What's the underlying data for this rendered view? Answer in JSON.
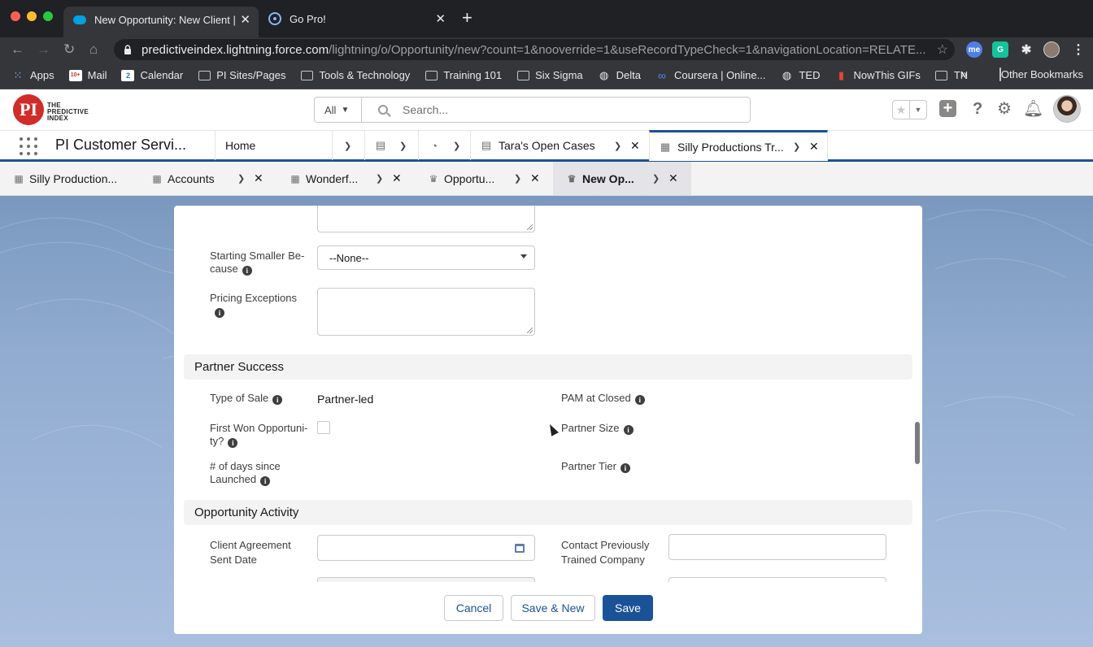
{
  "browser": {
    "tabs": [
      {
        "title": "New Opportunity: New Client |",
        "active": true
      },
      {
        "title": "Go Pro!",
        "active": false
      }
    ],
    "url_host": "predictiveindex.lightning.force.com",
    "url_path": "/lightning/o/Opportunity/new?count=1&nooverride=1&useRecordTypeCheck=1&navigationLocation=RELATE...",
    "bookmarks": [
      {
        "label": "Apps",
        "icon": "apps-grid-icon"
      },
      {
        "label": "Mail",
        "icon": "gmail-icon"
      },
      {
        "label": "Calendar",
        "icon": "calendar-icon"
      },
      {
        "label": "PI Sites/Pages",
        "icon": "folder-icon"
      },
      {
        "label": "Tools & Technology",
        "icon": "folder-icon"
      },
      {
        "label": "Training 101",
        "icon": "folder-icon"
      },
      {
        "label": "Six Sigma",
        "icon": "folder-icon"
      },
      {
        "label": "Delta",
        "icon": "globe-icon"
      },
      {
        "label": "Coursera | Online...",
        "icon": "coursera-icon"
      },
      {
        "label": "TED",
        "icon": "globe-icon"
      },
      {
        "label": "NowThis GIFs",
        "icon": "bookmark-icon"
      },
      {
        "label": "TN",
        "icon": "folder-icon"
      }
    ],
    "bookmarks_more": "»",
    "other_bookmarks": "Other Bookmarks",
    "calendar_badge": "2",
    "mail_badge": "10+"
  },
  "sf_header": {
    "logo_letters": "PI",
    "logo_text": [
      "THE",
      "PREDICTIVE",
      "INDEX"
    ],
    "search_scope": "All",
    "search_placeholder": "Search..."
  },
  "app_nav": {
    "app_name": "PI Customer Servi...",
    "tabs": [
      {
        "label": "Home"
      },
      {
        "label": ""
      },
      {
        "label": ""
      },
      {
        "label": "Tara's Open Cases"
      },
      {
        "label": "Silly Productions Tr..."
      }
    ]
  },
  "subtabs": [
    {
      "label": "Silly Production..."
    },
    {
      "label": "Accounts"
    },
    {
      "label": "Wonderf..."
    },
    {
      "label": "Opportu..."
    },
    {
      "label": "New Op..."
    }
  ],
  "form": {
    "starting_smaller": {
      "label": "Starting Smaller Be- cause",
      "value": "--None--"
    },
    "pricing_exceptions": {
      "label": "Pricing Exceptions"
    },
    "partner_section": {
      "title": "Partner Success",
      "type_of_sale": {
        "label": "Type of Sale",
        "value": "Partner-led"
      },
      "first_won": {
        "label": "First Won Opportuni- ty?"
      },
      "days_since": {
        "label": "# of days since Launched"
      },
      "pam_at_closed": {
        "label": "PAM at Closed"
      },
      "partner_size": {
        "label": "Partner Size"
      },
      "partner_tier": {
        "label": "Partner Tier"
      }
    },
    "activity_section": {
      "title": "Opportunity Activity",
      "client_agreement": {
        "label": "Client Agreement Sent Date"
      },
      "contact_previously": {
        "label": "Contact Previously Trained Company"
      }
    }
  },
  "footer": {
    "cancel": "Cancel",
    "save_new": "Save & New",
    "save": "Save"
  }
}
